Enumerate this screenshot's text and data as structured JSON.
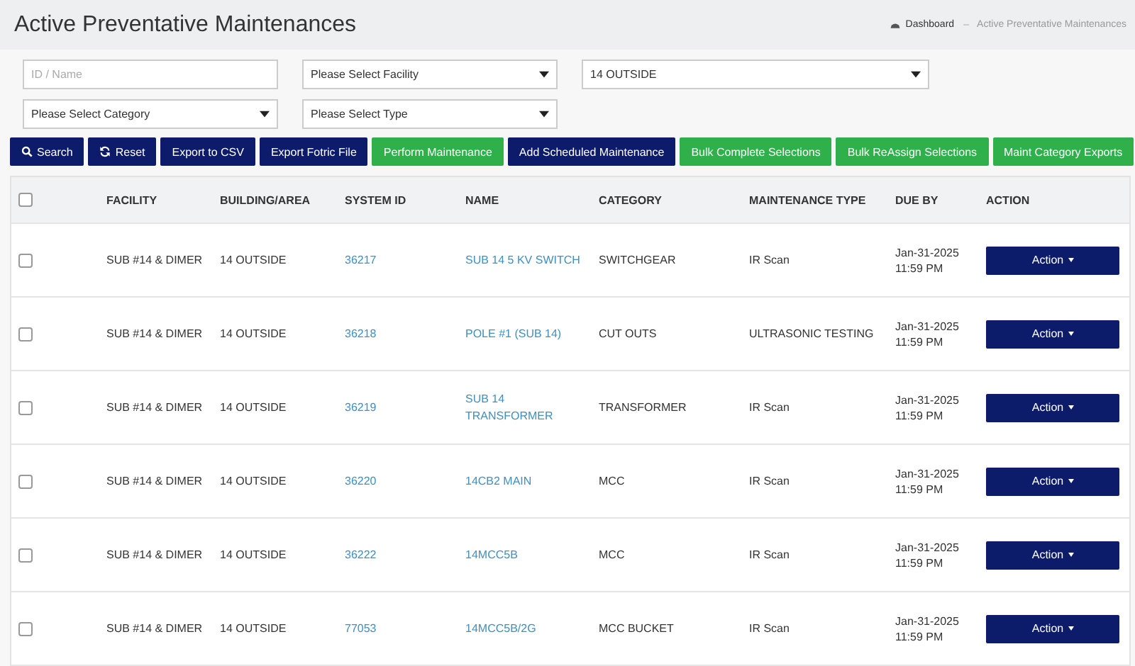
{
  "page_title": "Active Preventative Maintenances",
  "breadcrumb": [
    {
      "label": "Dashboard",
      "kind": "home"
    },
    {
      "label": "Active Preventative Maintenances",
      "kind": "current"
    }
  ],
  "filters": [
    {
      "kind": "text",
      "placeholder": "ID / Name"
    },
    {
      "kind": "select",
      "value": "Please Select Facility"
    },
    {
      "kind": "select",
      "value": "14 OUTSIDE"
    },
    {
      "kind": "select",
      "value": "Please Select Category"
    },
    {
      "kind": "select",
      "value": "Please Select Type"
    }
  ],
  "buttons": [
    {
      "label": "Search",
      "kind": "search"
    },
    {
      "label": "Reset",
      "kind": "reset"
    },
    {
      "label": "Export to CSV",
      "kind": "primary"
    },
    {
      "label": "Export Fotric File",
      "kind": "primary"
    },
    {
      "label": "Perform Maintenance",
      "kind": "success"
    },
    {
      "label": "Add Scheduled Maintenance",
      "kind": "primary"
    },
    {
      "label": "Bulk Complete Selections",
      "kind": "success"
    },
    {
      "label": "Bulk ReAssign Selections",
      "kind": "success"
    },
    {
      "label": "Maint Category Exports",
      "kind": "success"
    }
  ],
  "table": {
    "all_checked": false,
    "columns": [
      "FACILITY",
      "BUILDING/AREA",
      "SYSTEM ID",
      "NAME",
      "CATEGORY",
      "MAINTENANCE TYPE",
      "DUE BY",
      "ACTION"
    ],
    "rows": [
      {
        "checked": false,
        "facility": "SUB #14 & DIMER",
        "building": "14 OUTSIDE",
        "system_id": "36217",
        "name": "SUB 14 5 KV SWITCH",
        "category": "SWITCHGEAR",
        "type": "IR Scan",
        "due": [
          "Jan-31-2025",
          "11:59 PM"
        ],
        "action": "Action"
      },
      {
        "checked": false,
        "facility": "SUB #14 & DIMER",
        "building": "14 OUTSIDE",
        "system_id": "36218",
        "name": "POLE #1 (SUB 14)",
        "category": "CUT OUTS",
        "type": "ULTRASONIC TESTING",
        "due": [
          "Jan-31-2025",
          "11:59 PM"
        ],
        "action": "Action"
      },
      {
        "checked": false,
        "facility": "SUB #14 & DIMER",
        "building": "14 OUTSIDE",
        "system_id": "36219",
        "name": "SUB 14 TRANSFORMER",
        "category": "TRANSFORMER",
        "type": "IR Scan",
        "due": [
          "Jan-31-2025",
          "11:59 PM"
        ],
        "action": "Action"
      },
      {
        "checked": false,
        "facility": "SUB #14 & DIMER",
        "building": "14 OUTSIDE",
        "system_id": "36220",
        "name": "14CB2 MAIN",
        "category": "MCC",
        "type": "IR Scan",
        "due": [
          "Jan-31-2025",
          "11:59 PM"
        ],
        "action": "Action"
      },
      {
        "checked": false,
        "facility": "SUB #14 & DIMER",
        "building": "14 OUTSIDE",
        "system_id": "36222",
        "name": "14MCC5B",
        "category": "MCC",
        "type": "IR Scan",
        "due": [
          "Jan-31-2025",
          "11:59 PM"
        ],
        "action": "Action"
      },
      {
        "checked": false,
        "facility": "SUB #14 & DIMER",
        "building": "14 OUTSIDE",
        "system_id": "77053",
        "name": "14MCC5B/2G",
        "category": "MCC BUCKET",
        "type": "IR Scan",
        "due": [
          "Jan-31-2025",
          "11:59 PM"
        ],
        "action": "Action"
      }
    ]
  }
}
